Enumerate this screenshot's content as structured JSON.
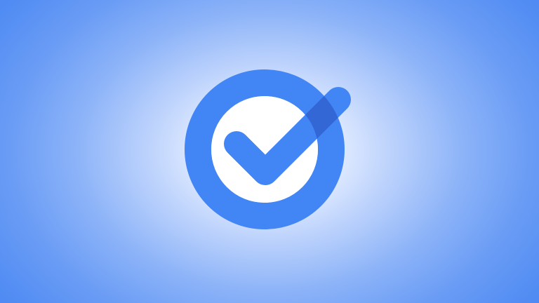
{
  "scene": {
    "subject": "tasks-logo",
    "colors": {
      "ring": "#4285f4",
      "ring_overlap": "#3367d6",
      "checkmark": "#4285f4",
      "background_center": "#ffffff",
      "background_edge": "#4f8bf3",
      "inner_fill": "#ffffff"
    },
    "icons": [
      "circle-ring-icon",
      "checkmark-icon"
    ]
  }
}
